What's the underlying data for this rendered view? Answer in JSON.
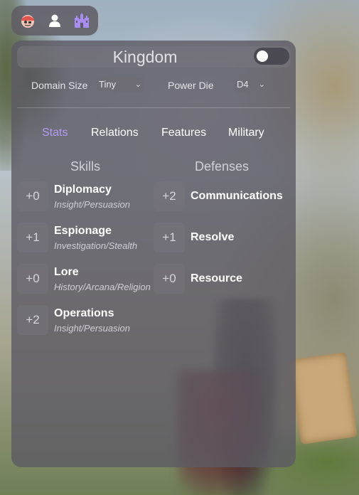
{
  "toolbar": {
    "icons": [
      "pirate-face-icon",
      "person-icon",
      "castle-icon"
    ],
    "colors": {
      "pirate": "#e0554f",
      "person": "#ffffff",
      "castle": "#a98cf0"
    }
  },
  "panel": {
    "title": "Kingdom",
    "toggle_on": false,
    "domain_size": {
      "label": "Domain Size",
      "value": "Tiny"
    },
    "power_die": {
      "label": "Power Die",
      "value": "D4"
    },
    "tabs": [
      {
        "label": "Stats",
        "active": true
      },
      {
        "label": "Relations",
        "active": false
      },
      {
        "label": "Features",
        "active": false
      },
      {
        "label": "Military",
        "active": false
      }
    ],
    "skills_heading": "Skills",
    "defenses_heading": "Defenses",
    "skills": [
      {
        "score": "+0",
        "name": "Diplomacy",
        "sub": "Insight/Persuasion"
      },
      {
        "score": "+1",
        "name": "Espionage",
        "sub": "Investigation/Stealth"
      },
      {
        "score": "+0",
        "name": "Lore",
        "sub": "History/Arcana/Religion"
      },
      {
        "score": "+2",
        "name": "Operations",
        "sub": "Insight/Persuasion"
      }
    ],
    "defenses": [
      {
        "score": "+2",
        "name": "Communications"
      },
      {
        "score": "+1",
        "name": "Resolve"
      },
      {
        "score": "+0",
        "name": "Resource"
      }
    ],
    "accent_color": "#b79cf5"
  }
}
